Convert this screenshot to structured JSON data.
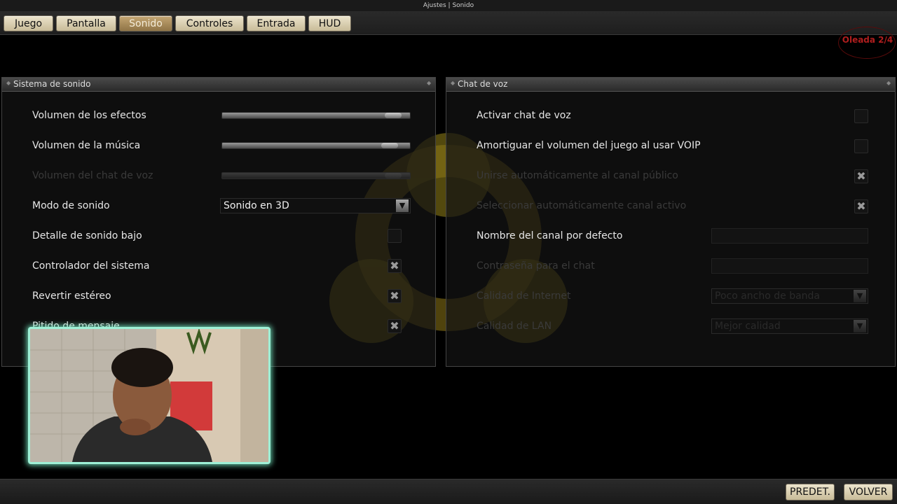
{
  "window": {
    "title": "Ajustes | Sonido"
  },
  "tabs": [
    {
      "label": "Juego"
    },
    {
      "label": "Pantalla"
    },
    {
      "label": "Sonido",
      "active": true
    },
    {
      "label": "Controles"
    },
    {
      "label": "Entrada"
    },
    {
      "label": "HUD"
    }
  ],
  "hud": {
    "wave_label": "Oleada 2/4"
  },
  "sound_panel": {
    "title": "Sistema de sonido",
    "effects_volume": {
      "label": "Volumen de los efectos",
      "value": 0.95
    },
    "music_volume": {
      "label": "Volumen de la música",
      "value": 0.93
    },
    "voice_chat_volume": {
      "label": "Volumen del chat de voz",
      "value": 0.95,
      "disabled": true
    },
    "sound_mode": {
      "label": "Modo de sonido",
      "value": "Sonido en 3D"
    },
    "low_sound_detail": {
      "label": "Detalle de sonido bajo",
      "checked": false
    },
    "system_driver": {
      "label": "Controlador del sistema",
      "checked": true
    },
    "reverse_stereo": {
      "label": "Revertir estéreo",
      "checked": true
    },
    "message_beep": {
      "label": "Pitido de mensaje",
      "checked": true
    }
  },
  "voice_panel": {
    "title": "Chat de voz",
    "enable_voice_chat": {
      "label": "Activar chat de voz",
      "checked": false
    },
    "duck_game_volume": {
      "label": "Amortiguar el volumen del juego al usar VOIP",
      "checked": false
    },
    "join_public_channel": {
      "label": "Unirse automáticamente al canal público",
      "checked": true,
      "disabled": true
    },
    "select_active_channel": {
      "label": "Seleccionar automáticamente canal activo",
      "checked": true,
      "disabled": true
    },
    "default_channel_name": {
      "label": "Nombre del canal por defecto",
      "value": ""
    },
    "chat_password": {
      "label": "Contraseña para el chat",
      "value": "",
      "disabled": true
    },
    "internet_quality": {
      "label": "Calidad de Internet",
      "value": "Poco ancho de banda",
      "disabled": true
    },
    "lan_quality": {
      "label": "Calidad de LAN",
      "value": "Mejor calidad",
      "disabled": true
    }
  },
  "bottom": {
    "defaults_label": "PREDET.",
    "back_label": "VOLVER"
  },
  "icons": {
    "checked_glyph": "✖",
    "dropdown_glyph": "▼",
    "corner_glyph": "◆"
  }
}
